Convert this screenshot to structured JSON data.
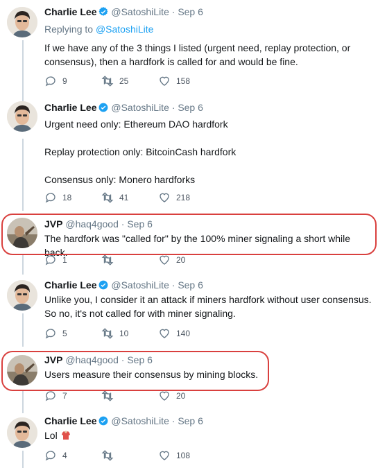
{
  "tweets": [
    {
      "name": "Charlie Lee",
      "verified": true,
      "handle": "@SatoshiLite",
      "dot": "·",
      "time": "Sep 6",
      "reply_prefix": "Replying to",
      "reply_handle": "@SatoshiLite",
      "text": "If we have any of the 3 things I listed (urgent need, replay protection, or consensus), then a hardfork is called for and would be fine.",
      "replies": "9",
      "retweets": "25",
      "likes": "158"
    },
    {
      "name": "Charlie Lee",
      "verified": true,
      "handle": "@SatoshiLite",
      "dot": "·",
      "time": "Sep 6",
      "text": "Urgent need only: Ethereum DAO hardfork\n\nReplay protection only: BitcoinCash hardfork\n\nConsensus only: Monero hardforks",
      "replies": "18",
      "retweets": "41",
      "likes": "218"
    },
    {
      "name": "JVP",
      "verified": false,
      "handle": "@haq4good",
      "dot": "·",
      "time": "Sep 6",
      "text": "The hardfork was \"called for\" by the 100% miner signaling a short while back.",
      "replies": "1",
      "retweets": "",
      "likes": "20"
    },
    {
      "name": "Charlie Lee",
      "verified": true,
      "handle": "@SatoshiLite",
      "dot": "·",
      "time": "Sep 6",
      "text": "Unlike you, I consider it an attack if miners hardfork without user consensus. So no, it's not called for with miner signaling.",
      "replies": "5",
      "retweets": "10",
      "likes": "140"
    },
    {
      "name": "JVP",
      "verified": false,
      "handle": "@haq4good",
      "dot": "·",
      "time": "Sep 6",
      "text": "Users measure their consensus by mining blocks.",
      "replies": "7",
      "retweets": "",
      "likes": "20"
    },
    {
      "name": "Charlie Lee",
      "verified": true,
      "handle": "@SatoshiLite",
      "dot": "·",
      "time": "Sep 6",
      "text": "Lol",
      "emoji": "shirt",
      "replies": "4",
      "retweets": "",
      "likes": "108"
    }
  ],
  "colors": {
    "highlight": "#d9403e",
    "link": "#1da1f2",
    "verified": "#1da1f2",
    "muted": "#657786"
  }
}
